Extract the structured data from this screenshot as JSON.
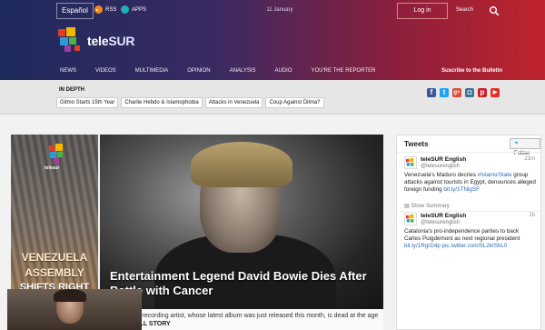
{
  "topbar": {
    "language_label": "Español",
    "rss_label": "RSS",
    "apps_label": "APPS",
    "date": "11 January",
    "login_label": "Log in",
    "search_label": "Search"
  },
  "logo": {
    "text_part1": "tele",
    "text_part2": "SUR"
  },
  "nav": {
    "items": [
      "NEWS",
      "VIDEOS",
      "MULTIMEDIA",
      "OPINION",
      "ANALYSIS",
      "AUDIO",
      "YOU'RE THE REPORTER"
    ],
    "subscribe_label": "Suscribe to the Bulletin"
  },
  "indepth": {
    "title": "IN DEPTH",
    "tags": [
      "Gitmo Starts 15th Year",
      "Charlie Hebdo & Islamophobia",
      "Attacks in Venezuela",
      "Coup Against Dilma?"
    ]
  },
  "social_icons": [
    "facebook-icon",
    "twitter-icon",
    "google-plus-icon",
    "instagram-icon",
    "pinterest-icon",
    "youtube-icon"
  ],
  "left_ad": {
    "brand": "telesur",
    "lines": [
      "VENEZUELA",
      "ASSEMBLY",
      "SHIFTS RIGHT"
    ]
  },
  "main_story": {
    "headline": "Entertainment Legend David Bowie Dies After Battle with Cancer",
    "summary": "The British recording artist, whose latest album was just released this month, is dead at the age of 69. |",
    "full_story_label": "FULL STORY"
  },
  "tweets": {
    "title": "Tweets",
    "follow_label": "Follow",
    "items": [
      {
        "name": "teleSUR English",
        "handle": "@telesurenglish",
        "time": "21m",
        "text_before": "Venezuela's Maduro decries ",
        "hashtag": "#IslamicState",
        "text_after": " group attacks against tourists in Egypt, denounces alleged foreign funding ",
        "link": "bit.ly/1TNlgSF",
        "show_label": "Show Summary"
      },
      {
        "name": "teleSUR English",
        "handle": "@telesurenglish",
        "time": "1h",
        "text_before": "Catalonia's pro-independence parties to back Carles Puigdemont as next regional president ",
        "link": "bit.ly/1RgrD4p pic.twitter.com/5L2kIShL0"
      }
    ]
  },
  "colors": {
    "header_left": "#1e2a5c",
    "header_right": "#c0242d",
    "link": "#2a6bb5",
    "rss": "#f0871f",
    "apps": "#21b0b9"
  }
}
